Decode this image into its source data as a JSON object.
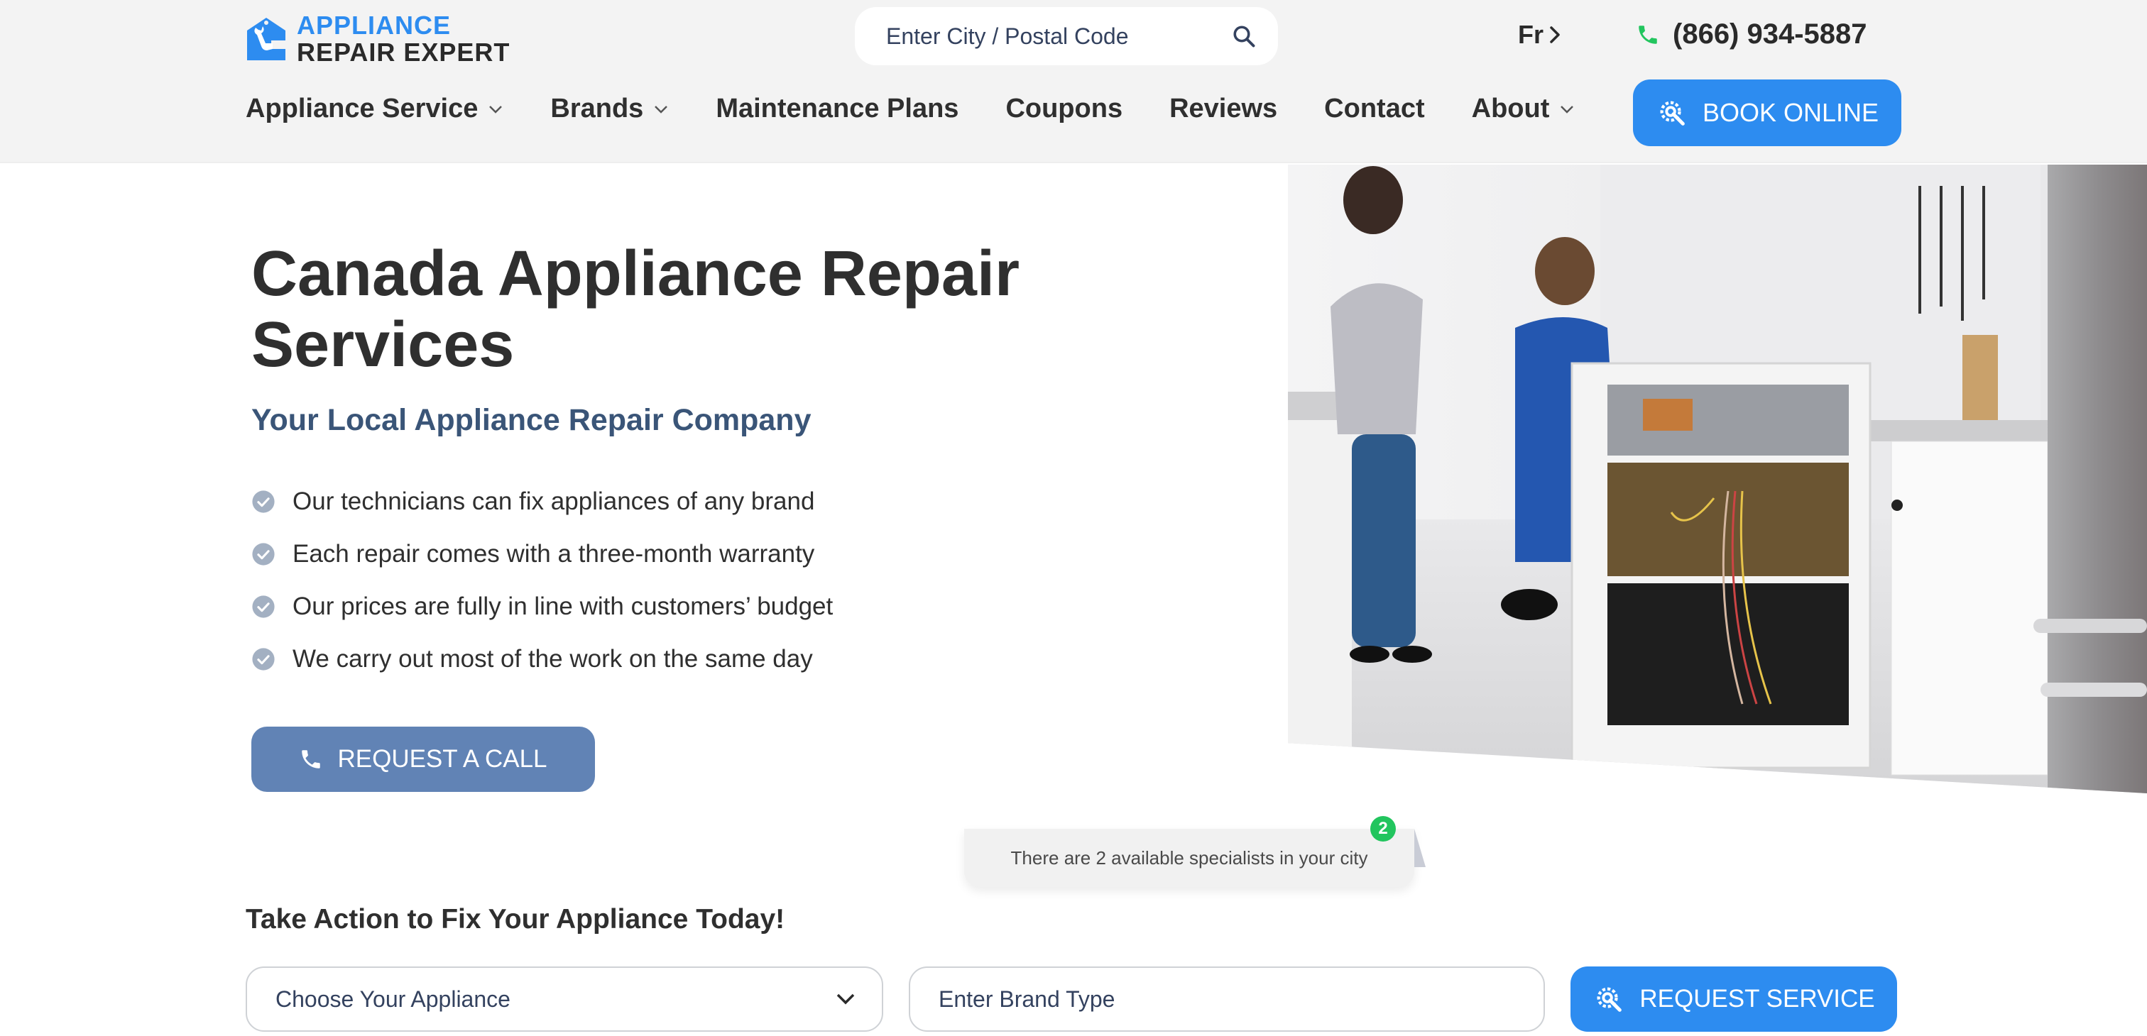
{
  "header": {
    "logo": {
      "line1": "APPLIANCE",
      "line2": "REPAIR EXPERT",
      "icon": "house-wrench-icon"
    },
    "search": {
      "placeholder": "Enter City / Postal Code",
      "value": "",
      "icon": "search-icon"
    },
    "language": {
      "label": "Fr",
      "icon": "chevron-right-icon"
    },
    "phone": {
      "number": "(866) 934-5887",
      "icon": "phone-icon"
    },
    "nav": [
      {
        "label": "Appliance Service",
        "has_dropdown": true
      },
      {
        "label": "Brands",
        "has_dropdown": true
      },
      {
        "label": "Maintenance Plans",
        "has_dropdown": false
      },
      {
        "label": "Coupons",
        "has_dropdown": false
      },
      {
        "label": "Reviews",
        "has_dropdown": false
      },
      {
        "label": "Contact",
        "has_dropdown": false
      },
      {
        "label": "About",
        "has_dropdown": true
      }
    ],
    "book_button": {
      "label": "BOOK ONLINE",
      "icon": "gear-wrench-icon"
    }
  },
  "hero": {
    "title": "Canada Appliance Repair Services",
    "subtitle": "Your Local Appliance Repair Company",
    "features": [
      "Our technicians can fix appliances of any brand",
      "Each repair comes with a three-month warranty",
      "Our prices are fully in line with customers’ budget",
      "We carry out most of the work on the same day"
    ],
    "call_button": {
      "label": "REQUEST A CALL",
      "icon": "phone-icon"
    },
    "image_alt": "Technician repairing a dishwasher while a woman watches in a kitchen"
  },
  "toast": {
    "text": "There are 2 available specialists in your city",
    "badge_count": "2"
  },
  "action": {
    "title": "Take Action to Fix Your Appliance Today!",
    "appliance_select": {
      "value": "Choose Your Appliance"
    },
    "brand_input": {
      "placeholder": "Enter Brand Type",
      "value": ""
    },
    "request_button": {
      "label": "REQUEST SERVICE",
      "icon": "gear-wrench-icon"
    }
  },
  "colors": {
    "brand_blue": "#2d8cf0",
    "call_button": "#6183b5",
    "subtitle": "#3a5578",
    "phone_green": "#22c55e",
    "header_bg": "#f3f3f3"
  }
}
